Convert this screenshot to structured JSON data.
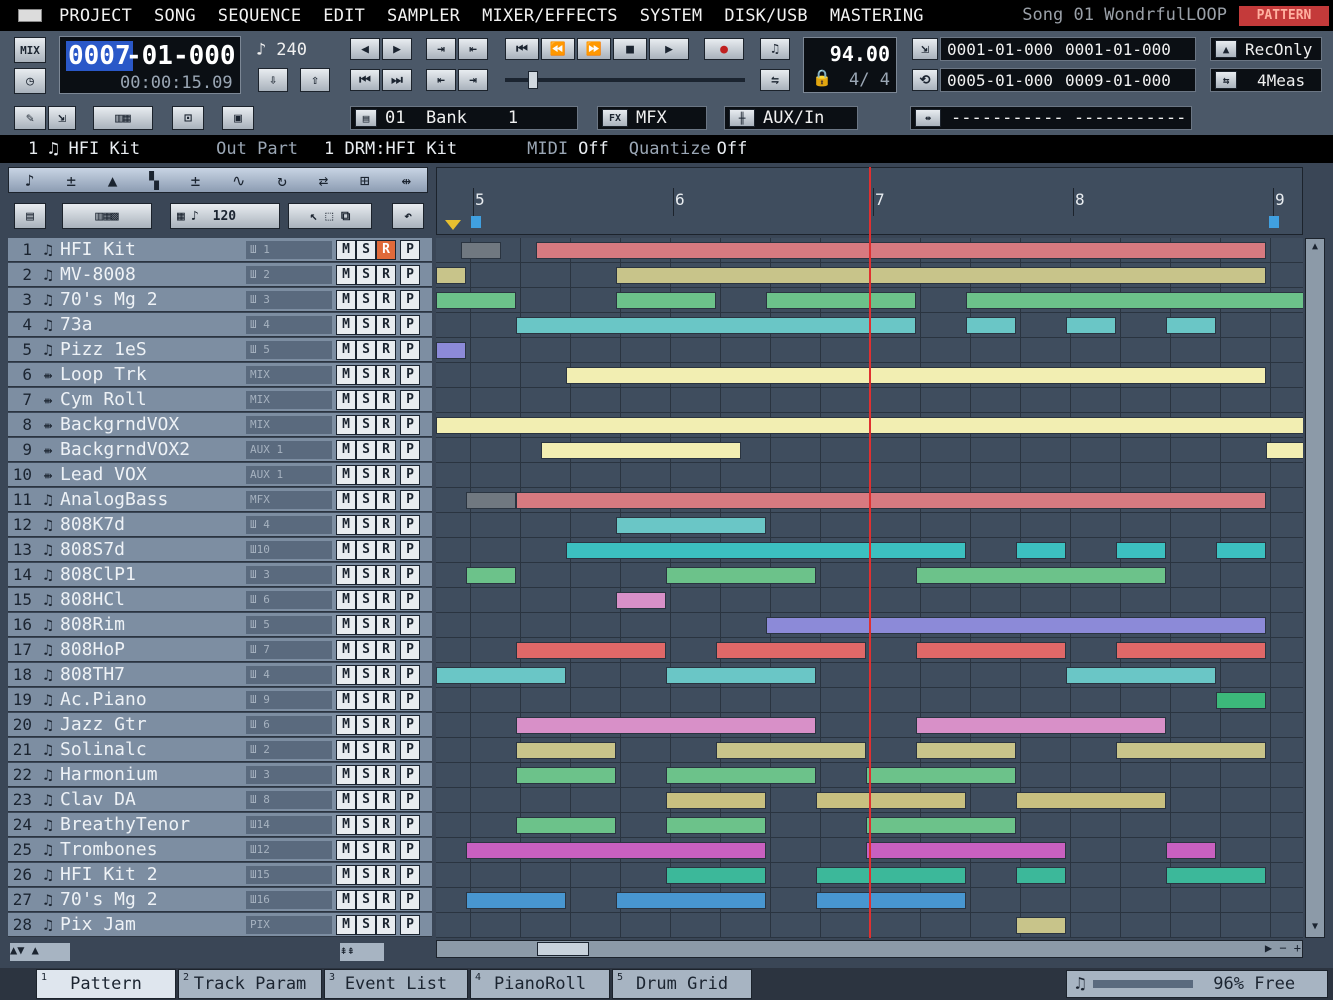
{
  "menu": {
    "items": [
      "PROJECT",
      "SONG",
      "SEQUENCE",
      "EDIT",
      "SAMPLER",
      "MIXER/EFFECTS",
      "SYSTEM",
      "DISK/USB",
      "MASTERING"
    ],
    "song_title": "Song 01 WondrfulLOOP",
    "mode_badge": "PATTERN"
  },
  "transport": {
    "mix_label": "MIX",
    "position": "0007",
    "position_rest": "-01-000",
    "time": "00:00:15.09",
    "resolution": "240",
    "tempo": "94.00",
    "time_sig": "4/ 4",
    "loop_start": "0001-01-000",
    "loop_end": "0001-01-000",
    "punch_start": "0005-01-000",
    "punch_end": "0009-01-000",
    "rec_mode": "RecOnly",
    "loop_length": "4Meas"
  },
  "row3": {
    "bank": "01  Bank    1",
    "mfx": "MFX",
    "aux": "AUX/In",
    "locator": "----------- -----------"
  },
  "part": {
    "num": "1",
    "name": "HFI Kit",
    "out_label": "Out Part",
    "out_value": "1 DRM:HFI Kit",
    "midi_label": "MIDI",
    "midi_value": "Off",
    "quant_label": "Quantize",
    "quant_value": "Off"
  },
  "edit": {
    "grid_value": "120"
  },
  "ruler": {
    "labels": [
      "5",
      "6",
      "7",
      "8",
      "9"
    ]
  },
  "tracks": [
    {
      "n": "1",
      "name": "HFI Kit",
      "out": "Ш 1",
      "type": "note",
      "rec": true
    },
    {
      "n": "2",
      "name": "MV-8008",
      "out": "Ш 2",
      "type": "note"
    },
    {
      "n": "3",
      "name": "70's Mg 2",
      "out": "Ш 3",
      "type": "note"
    },
    {
      "n": "4",
      "name": "73a",
      "out": "Ш 4",
      "type": "note"
    },
    {
      "n": "5",
      "name": "Pizz 1eS",
      "out": "Ш 5",
      "type": "note"
    },
    {
      "n": "6",
      "name": "Loop Trk",
      "out": "MIX",
      "type": "audio"
    },
    {
      "n": "7",
      "name": "Cym Roll",
      "out": "MIX",
      "type": "audio"
    },
    {
      "n": "8",
      "name": "BackgrndVOX",
      "out": "MIX",
      "type": "audio"
    },
    {
      "n": "9",
      "name": "BackgrndVOX2",
      "out": "AUX 1",
      "type": "audio"
    },
    {
      "n": "10",
      "name": "Lead VOX",
      "out": "AUX 1",
      "type": "audio"
    },
    {
      "n": "11",
      "name": "AnalogBass",
      "out": "MFX",
      "type": "note"
    },
    {
      "n": "12",
      "name": "808K7d",
      "out": "Ш 4",
      "type": "note"
    },
    {
      "n": "13",
      "name": "808S7d",
      "out": "Ш10",
      "type": "note"
    },
    {
      "n": "14",
      "name": "808ClP1",
      "out": "Ш 3",
      "type": "note"
    },
    {
      "n": "15",
      "name": "808HCl",
      "out": "Ш 6",
      "type": "note"
    },
    {
      "n": "16",
      "name": "808Rim",
      "out": "Ш 5",
      "type": "note"
    },
    {
      "n": "17",
      "name": "808HoP",
      "out": "Ш 7",
      "type": "note"
    },
    {
      "n": "18",
      "name": "808TH7",
      "out": "Ш 4",
      "type": "note"
    },
    {
      "n": "19",
      "name": "Ac.Piano",
      "out": "Ш 9",
      "type": "note"
    },
    {
      "n": "20",
      "name": "Jazz Gtr",
      "out": "Ш 6",
      "type": "note"
    },
    {
      "n": "21",
      "name": "Solinalc",
      "out": "Ш 2",
      "type": "note"
    },
    {
      "n": "22",
      "name": "Harmonium",
      "out": "Ш 3",
      "type": "note"
    },
    {
      "n": "23",
      "name": "Clav DA",
      "out": "Ш 8",
      "type": "note"
    },
    {
      "n": "24",
      "name": "BreathyTenor",
      "out": "Ш14",
      "type": "note"
    },
    {
      "n": "25",
      "name": "Trombones",
      "out": "Ш12",
      "type": "note"
    },
    {
      "n": "26",
      "name": "HFI Kit 2",
      "out": "Ш15",
      "type": "note"
    },
    {
      "n": "27",
      "name": "70's Mg 2",
      "out": "Ш16",
      "type": "note"
    },
    {
      "n": "28",
      "name": "Pix Jam",
      "out": "PIX",
      "type": "note"
    }
  ],
  "track_buttons": [
    "M",
    "S",
    "R",
    "P"
  ],
  "clips": [
    [
      [
        "#707880",
        0.5,
        1.3
      ],
      [
        "#d77a80",
        2,
        16.6
      ]
    ],
    [
      [
        "#c8c48a",
        0,
        0.6
      ],
      [
        "#c8c48a",
        3.6,
        16.6
      ]
    ],
    [
      [
        "#6cc28a",
        0,
        1.6
      ],
      [
        "#6cc28a",
        3.6,
        5.6
      ],
      [
        "#6cc28a",
        6.6,
        9.6
      ],
      [
        "#6cc28a",
        10.6,
        17.4
      ]
    ],
    [
      [
        "#6ac6c6",
        1.6,
        9.6
      ],
      [
        "#6ac6c6",
        10.6,
        11.6
      ],
      [
        "#6ac6c6",
        12.6,
        13.6
      ],
      [
        "#6ac6c6",
        14.6,
        15.6
      ]
    ],
    [
      [
        "#8c8ad8",
        0,
        0.6
      ]
    ],
    [
      [
        "#f2eeb2",
        2.6,
        16.6
      ]
    ],
    [],
    [
      [
        "#f2eeb2",
        0,
        17.4
      ]
    ],
    [
      [
        "#f2eeb2",
        2.1,
        6.1
      ],
      [
        "#f2eeb2",
        16.6,
        17.4
      ]
    ],
    [],
    [
      [
        "#707880",
        0.6,
        1.6
      ],
      [
        "#d77a80",
        1.6,
        16.6
      ]
    ],
    [
      [
        "#6ac6c6",
        3.6,
        6.6
      ]
    ],
    [
      [
        "#3cc0c0",
        2.6,
        10.6
      ],
      [
        "#3cc0c0",
        11.6,
        12.6
      ],
      [
        "#3cc0c0",
        13.6,
        14.6
      ],
      [
        "#3cc0c0",
        15.6,
        16.6
      ]
    ],
    [
      [
        "#6cc28a",
        0.6,
        1.6
      ],
      [
        "#6cc28a",
        4.6,
        7.6
      ],
      [
        "#6cc28a",
        9.6,
        14.6
      ]
    ],
    [
      [
        "#d890c8",
        3.6,
        4.6
      ]
    ],
    [
      [
        "#8c8ad8",
        6.6,
        16.6
      ]
    ],
    [
      [
        "#e06868",
        1.6,
        4.6
      ],
      [
        "#e06868",
        5.6,
        8.6
      ],
      [
        "#e06868",
        9.6,
        12.6
      ],
      [
        "#e06868",
        13.6,
        16.6
      ]
    ],
    [
      [
        "#6ac6c6",
        0,
        2.6
      ],
      [
        "#6ac6c6",
        4.6,
        7.6
      ],
      [
        "#6ac6c6",
        12.6,
        15.6
      ]
    ],
    [
      [
        "#3cb87a",
        15.6,
        16.6
      ]
    ],
    [
      [
        "#d890c8",
        1.6,
        7.6
      ],
      [
        "#d890c8",
        9.6,
        14.6
      ]
    ],
    [
      [
        "#c8c48a",
        1.6,
        3.6
      ],
      [
        "#c8c48a",
        5.6,
        8.6
      ],
      [
        "#c8c48a",
        9.6,
        11.6
      ],
      [
        "#c8c48a",
        13.6,
        16.6
      ]
    ],
    [
      [
        "#6cc28a",
        1.6,
        3.6
      ],
      [
        "#6cc28a",
        4.6,
        7.6
      ],
      [
        "#6cc28a",
        8.6,
        11.6
      ]
    ],
    [
      [
        "#c8c080",
        4.6,
        6.6
      ],
      [
        "#c8c080",
        7.6,
        10.6
      ],
      [
        "#c8c080",
        11.6,
        14.6
      ]
    ],
    [
      [
        "#6cc28a",
        1.6,
        3.6
      ],
      [
        "#6cc28a",
        4.6,
        6.6
      ],
      [
        "#6cc28a",
        8.6,
        11.6
      ]
    ],
    [
      [
        "#c860c0",
        0.6,
        6.6
      ],
      [
        "#c860c0",
        8.6,
        12.6
      ],
      [
        "#c860c0",
        14.6,
        15.6
      ]
    ],
    [
      [
        "#3cb89a",
        4.6,
        6.6
      ],
      [
        "#3cb89a",
        7.6,
        10.6
      ],
      [
        "#3cb89a",
        11.6,
        12.6
      ],
      [
        "#3cb89a",
        14.6,
        16.6
      ]
    ],
    [
      [
        "#4896d0",
        0.6,
        2.6
      ],
      [
        "#4896d0",
        3.6,
        6.6
      ],
      [
        "#4896d0",
        7.6,
        10.6
      ]
    ],
    [
      [
        "#c8c48a",
        11.6,
        12.6
      ]
    ]
  ],
  "tabs": [
    {
      "k": "1",
      "label": "Pattern"
    },
    {
      "k": "2",
      "label": "Track Param"
    },
    {
      "k": "3",
      "label": "Event List"
    },
    {
      "k": "4",
      "label": "PianoRoll"
    },
    {
      "k": "5",
      "label": "Drum Grid"
    }
  ],
  "memory": "96% Free"
}
